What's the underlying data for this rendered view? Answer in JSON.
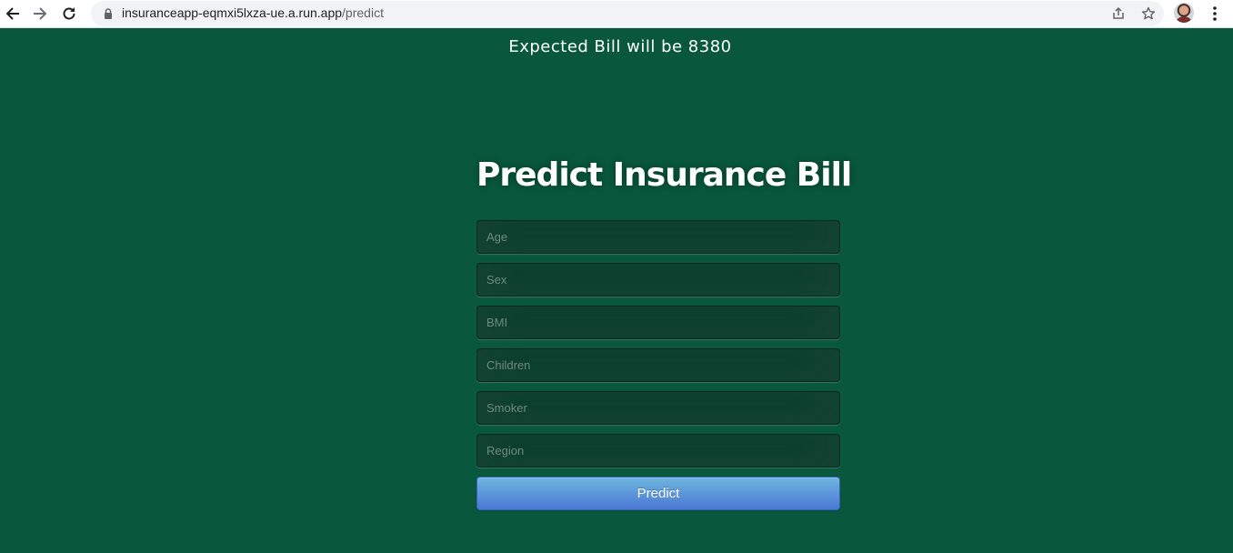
{
  "browser": {
    "url_host": "insuranceapp-eqmxi5lxza-ue.a.run.app",
    "url_path": "/predict",
    "icons": [
      "back-arrow-icon",
      "forward-arrow-icon",
      "reload-icon",
      "lock-icon",
      "share-icon",
      "star-icon",
      "kebab-menu-icon"
    ]
  },
  "page": {
    "result_text": "Expected Bill will be 8380",
    "title": "Predict Insurance Bill",
    "form": {
      "age_placeholder": "Age",
      "sex_placeholder": "Sex",
      "bmi_placeholder": "BMI",
      "children_placeholder": "Children",
      "smoker_placeholder": "Smoker",
      "region_placeholder": "Region",
      "submit_label": "Predict"
    }
  },
  "colors": {
    "background": "#09573d",
    "button_top": "#6eb6de",
    "button_bottom": "#4a77d4"
  }
}
